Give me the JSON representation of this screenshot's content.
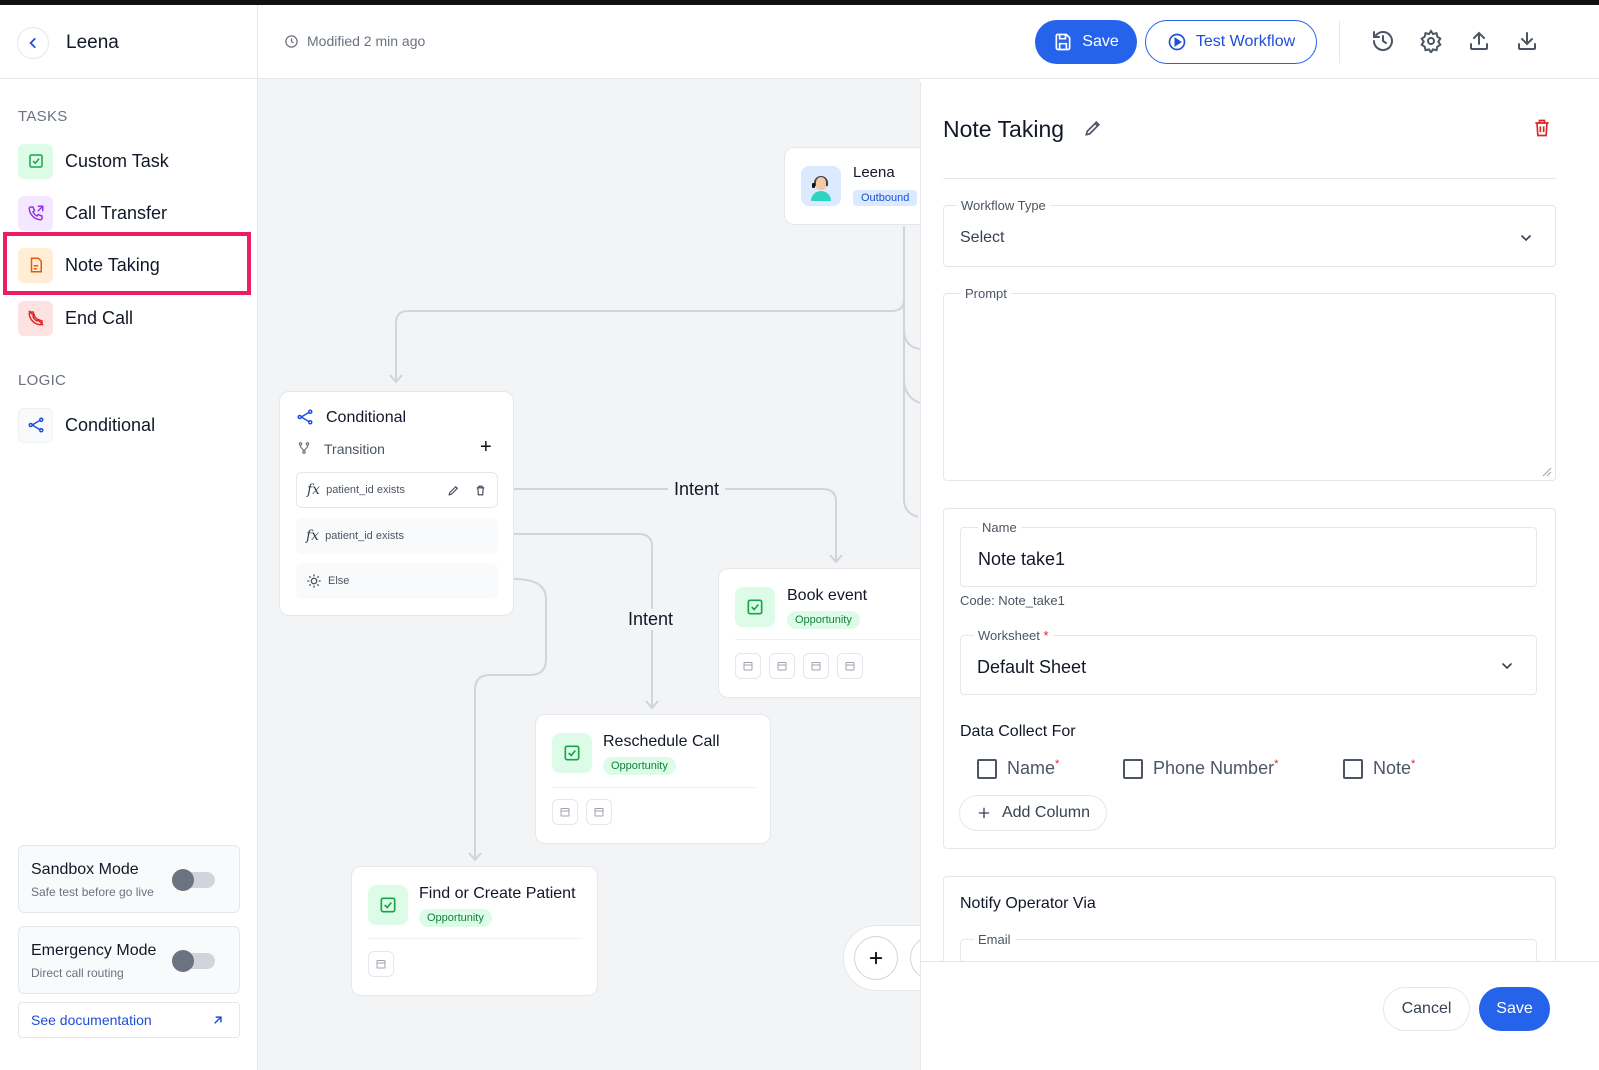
{
  "header": {
    "agent_name": "Leena",
    "modified": "Modified 2 min ago",
    "save_label": "Save",
    "test_label": "Test Workflow"
  },
  "sidebar": {
    "tasks_label": "TASKS",
    "tasks": [
      {
        "label": "Custom Task",
        "icon": "check-square-icon"
      },
      {
        "label": "Call Transfer",
        "icon": "phone-transfer-icon"
      },
      {
        "label": "Note Taking",
        "icon": "note-icon"
      },
      {
        "label": "End Call",
        "icon": "phone-off-icon"
      }
    ],
    "logic_label": "LOGIC",
    "logic": [
      {
        "label": "Conditional",
        "icon": "branch-icon"
      }
    ],
    "sandbox": {
      "title": "Sandbox Mode",
      "subtitle": "Safe test before go live",
      "on": false
    },
    "emergency": {
      "title": "Emergency Mode",
      "subtitle": "Direct call routing",
      "on": false
    },
    "doc_link": "See documentation"
  },
  "canvas": {
    "agent_node": {
      "name": "Leena",
      "badge": "Outbound"
    },
    "conditional": {
      "title": "Conditional",
      "transition": "Transition",
      "rows": [
        "patient_id exists",
        "patient_id exists",
        "Else"
      ]
    },
    "edge_labels": [
      "Intent",
      "Intent"
    ],
    "nodes": [
      {
        "title": "Book event",
        "badge": "Opportunity"
      },
      {
        "title": "Reschedule Call",
        "badge": "Opportunity"
      },
      {
        "title": "Find or Create Patient",
        "badge": "Opportunity"
      }
    ]
  },
  "panel": {
    "title": "Note Taking",
    "workflow_type": {
      "label": "Workflow Type",
      "value": "Select"
    },
    "prompt": {
      "label": "Prompt",
      "value": ""
    },
    "name": {
      "label": "Name",
      "value": "Note take1"
    },
    "code": "Code: Note_take1",
    "worksheet": {
      "label": "Worksheet",
      "required": "*",
      "value": "Default Sheet"
    },
    "data_collect": {
      "label": "Data Collect For",
      "columns": [
        {
          "label": "Name",
          "required": "*",
          "checked": false
        },
        {
          "label": "Phone Number",
          "required": "*",
          "checked": false
        },
        {
          "label": "Note",
          "required": "*",
          "checked": false
        }
      ],
      "add_label": "Add Column"
    },
    "notify": {
      "label": "Notify Operator Via",
      "email_label": "Email"
    },
    "cancel_label": "Cancel",
    "save_label": "Save"
  },
  "colors": {
    "accent": "#2563eb",
    "highlight": "#e91e63",
    "success_bg": "#dcfce7",
    "danger": "#dc2626"
  }
}
